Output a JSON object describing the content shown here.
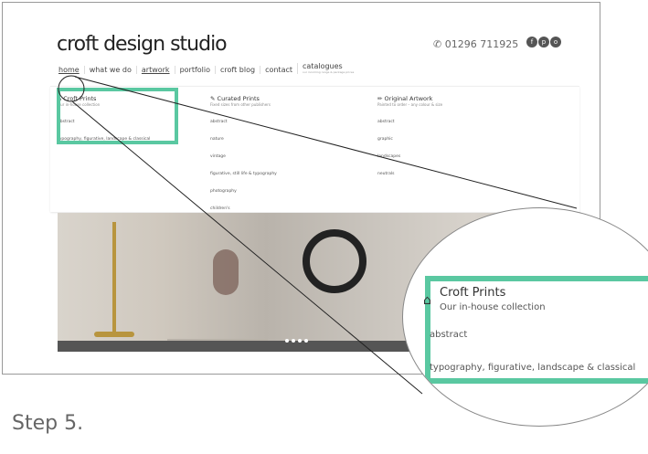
{
  "brand": "croft design studio",
  "phone": "01296 711925",
  "social": [
    "f",
    "p",
    "o"
  ],
  "nav": [
    "home",
    "what we do",
    "artwork",
    "portfolio",
    "croft blog",
    "contact"
  ],
  "catalogues": {
    "label": "catalogues",
    "sub": "our incoming range & package prices"
  },
  "menu": {
    "croft": {
      "title": "Croft Prints",
      "sub": "Our in-house collection",
      "items": [
        "abstract",
        "typography, figurative, landscape & classical"
      ]
    },
    "curated": {
      "title": "Curated Prints",
      "sub": "Fixed sizes from other publishers",
      "items": [
        "abstract",
        "nature",
        "vintage",
        "figurative, still life & typography",
        "photography",
        "children's"
      ]
    },
    "original": {
      "title": "Original Artwork",
      "sub": "Painted to order – any colour & size",
      "items": [
        "abstract",
        "graphic",
        "landscapes",
        "neutrals"
      ]
    }
  },
  "magnified": {
    "title": "Croft Prints",
    "sub": "Our in-house collection",
    "item1": "abstract",
    "item2": "typography, figurative, landscape & classical"
  },
  "step": "Step 5.",
  "colors": {
    "highlight": "#5ac8a1"
  },
  "icons": [
    "phone-icon",
    "home-icon",
    "brush-icon",
    "pencil-icon"
  ]
}
